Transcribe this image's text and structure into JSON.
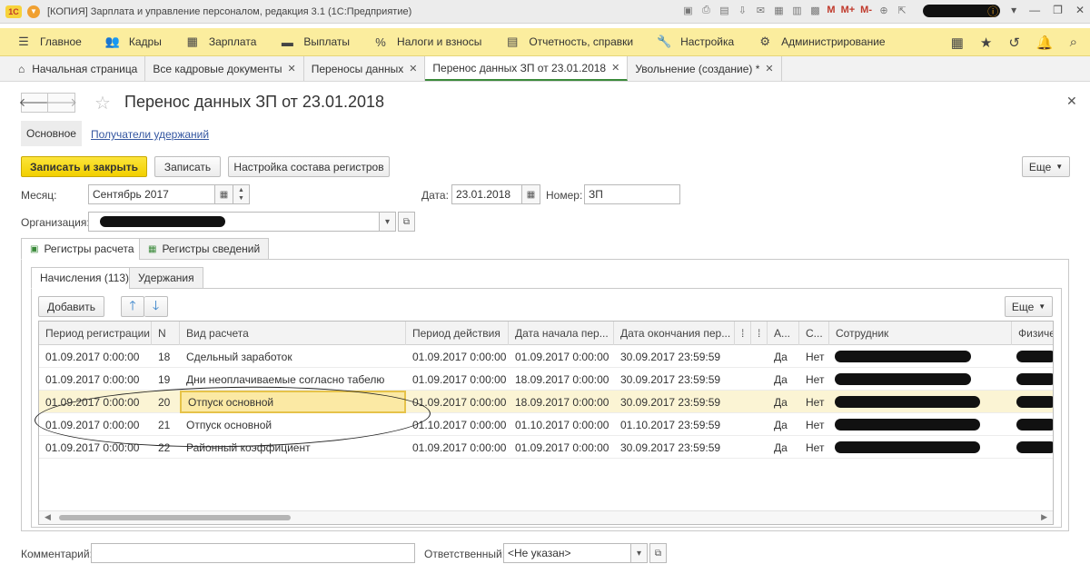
{
  "titlebar": {
    "logo": "1С",
    "title": "[КОПИЯ] Зарплата и управление персоналом, редакция 3.1  (1С:Предприятие)",
    "m_buttons": [
      "M",
      "M+",
      "M-"
    ]
  },
  "main_menu": [
    {
      "label": "Главное",
      "icon": "hamburger-icon"
    },
    {
      "label": "Кадры",
      "icon": "people-icon"
    },
    {
      "label": "Зарплата",
      "icon": "calculator-icon"
    },
    {
      "label": "Выплаты",
      "icon": "wallet-icon"
    },
    {
      "label": "Налоги и взносы",
      "icon": "percent-icon"
    },
    {
      "label": "Отчетность, справки",
      "icon": "document-icon"
    },
    {
      "label": "Настройка",
      "icon": "wrench-icon"
    },
    {
      "label": "Администрирование",
      "icon": "gear-icon"
    }
  ],
  "open_tabs": [
    {
      "label": "Начальная страница"
    },
    {
      "label": "Все кадровые документы"
    },
    {
      "label": "Переносы данных"
    },
    {
      "label": "Перенос данных ЗП от 23.01.2018"
    },
    {
      "label": "Увольнение (создание) *"
    }
  ],
  "form": {
    "title": "Перенос данных ЗП от 23.01.2018",
    "subnav_main": "Основное",
    "subnav_link": "Получатели удержаний",
    "buttons": {
      "save_close": "Записать и закрыть",
      "save": "Записать",
      "registers_setup": "Настройка состава регистров",
      "more": "Еще"
    },
    "month_label": "Месяц:",
    "month_value": "Сентябрь 2017",
    "date_label": "Дата:",
    "date_value": "23.01.2018",
    "number_label": "Номер:",
    "number_value": "ЗП",
    "org_label": "Организация:",
    "comment_label": "Комментарий:",
    "comment_value": "",
    "responsible_label": "Ответственный:",
    "responsible_value": "<Не указан>"
  },
  "register_tabs": [
    "Регистры расчета",
    "Регистры сведений"
  ],
  "accrual_tabs": [
    "Начисления (113)",
    "Удержания"
  ],
  "table_toolbar": {
    "add": "Добавить",
    "more": "Еще"
  },
  "table": {
    "columns": [
      "Период регистрации",
      "N",
      "Вид расчета",
      "Период действия",
      "Дата начала пер...",
      "Дата окончания пер...",
      "",
      "",
      "А...",
      "С...",
      "Сотрудник",
      "Физиче"
    ],
    "rows": [
      {
        "period": "01.09.2017 0:00:00",
        "n": "18",
        "kind": "Сдельный заработок",
        "action": "01.09.2017 0:00:00",
        "start": "01.09.2017 0:00:00",
        "end": "30.09.2017 23:59:59",
        "a": "Да",
        "s": "Нет"
      },
      {
        "period": "01.09.2017 0:00:00",
        "n": "19",
        "kind": "Дни неоплачиваемые согласно табелю",
        "action": "01.09.2017 0:00:00",
        "start": "18.09.2017 0:00:00",
        "end": "30.09.2017 23:59:59",
        "a": "Да",
        "s": "Нет"
      },
      {
        "period": "01.09.2017 0:00:00",
        "n": "20",
        "kind": "Отпуск основной",
        "action": "01.09.2017 0:00:00",
        "start": "18.09.2017 0:00:00",
        "end": "30.09.2017 23:59:59",
        "a": "Да",
        "s": "Нет"
      },
      {
        "period": "01.09.2017 0:00:00",
        "n": "21",
        "kind": "Отпуск основной",
        "action": "01.10.2017 0:00:00",
        "start": "01.10.2017 0:00:00",
        "end": "01.10.2017 23:59:59",
        "a": "Да",
        "s": "Нет"
      },
      {
        "period": "01.09.2017 0:00:00",
        "n": "22",
        "kind": "Районный коэффициент",
        "action": "01.09.2017 0:00:00",
        "start": "01.09.2017 0:00:00",
        "end": "30.09.2017 23:59:59",
        "a": "Да",
        "s": "Нет"
      }
    ],
    "selected_row": 2
  }
}
